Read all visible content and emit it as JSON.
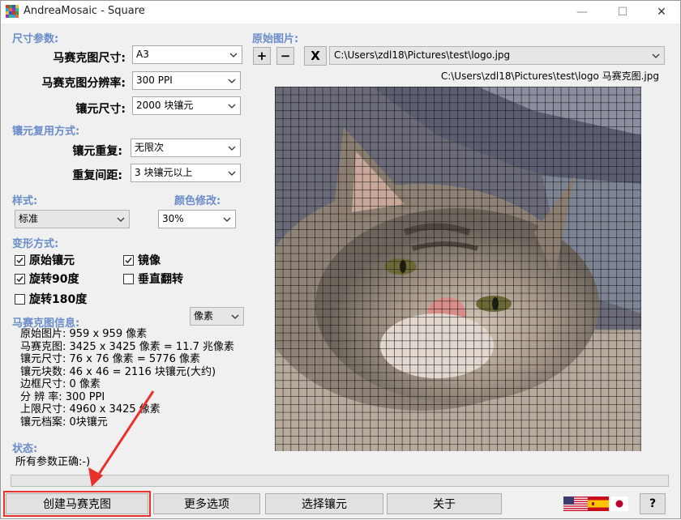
{
  "window": {
    "title": "AndreaMosaic - Square",
    "minimize": "—",
    "maximize": "☐",
    "close": "✕"
  },
  "size_params": {
    "section": "尺寸参数:",
    "mosaic_size_label": "马赛克图尺寸:",
    "mosaic_size_value": "A3",
    "resolution_label": "马赛克图分辨率:",
    "resolution_value": "300 PPI",
    "tile_size_label": "镶元尺寸:",
    "tile_size_value": "2000 块镶元"
  },
  "reuse": {
    "section": "镶元复用方式:",
    "repeat_label": "镶元重复:",
    "repeat_value": "无限次",
    "distance_label": "重复间距:",
    "distance_value": "3 块镶元以上"
  },
  "style": {
    "section": "样式:",
    "value": "标准",
    "color_section": "颜色修改:",
    "color_value": "30%"
  },
  "transform": {
    "section": "变形方式:",
    "options": [
      {
        "label": "原始镶元",
        "checked": true
      },
      {
        "label": "镜像",
        "checked": true
      },
      {
        "label": "旋转90度",
        "checked": true
      },
      {
        "label": "垂直翻转",
        "checked": false
      },
      {
        "label": "旋转180度",
        "checked": false
      }
    ]
  },
  "mosaic_info": {
    "section": "马赛克图信息:",
    "unit_value": "像素",
    "lines": [
      "原始图片: 959 x 959 像素",
      "马赛克图: 3425 x 3425 像素 = 11.7 兆像素",
      "镶元尺寸: 76 x 76 像素 = 5776 像素",
      "镶元块数: 46 x 46 = 2116 块镶元(大约)",
      "边框尺寸: 0 像素",
      "分 辨 率: 300 PPI",
      "上限尺寸: 4960 x 3425 像素",
      "镶元档案: 0块镶元"
    ]
  },
  "status": {
    "section": "状态:",
    "text": "所有参数正确:-)"
  },
  "original": {
    "section": "原始图片:",
    "add_label": "+",
    "remove_label": "−",
    "clear_label": "X",
    "path": "C:\\Users\\zdl18\\Pictures\\test\\logo.jpg",
    "output_path": "C:\\Users\\zdl18\\Pictures\\test\\logo 马赛克图.jpg"
  },
  "buttons": {
    "create": "创建马赛克图",
    "more": "更多选项",
    "select_tiles": "选择镶元",
    "about": "关于",
    "help": "?"
  }
}
